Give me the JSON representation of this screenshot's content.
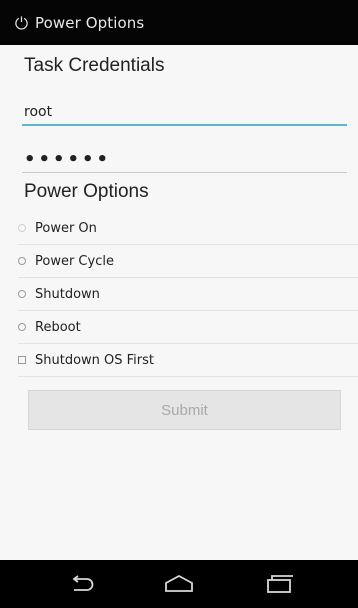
{
  "header": {
    "title": "Power Options",
    "icon": "power-icon"
  },
  "credentials": {
    "heading": "Task Credentials",
    "username_value": "root",
    "password_value": "••••••"
  },
  "power": {
    "heading": "Power Options",
    "options": [
      {
        "label": "Power On",
        "selected": false
      },
      {
        "label": "Power Cycle",
        "selected": false
      },
      {
        "label": "Shutdown",
        "selected": false
      },
      {
        "label": "Reboot",
        "selected": false
      }
    ],
    "shutdown_os_first": {
      "label": "Shutdown OS First",
      "checked": false
    }
  },
  "actions": {
    "submit_label": "Submit"
  },
  "navbar": {
    "back_icon": "back-icon",
    "home_icon": "home-icon",
    "recents_icon": "recents-icon"
  },
  "colors": {
    "topbar": "#050505",
    "accent": "#5fb4cf",
    "navbar": "#000000"
  }
}
